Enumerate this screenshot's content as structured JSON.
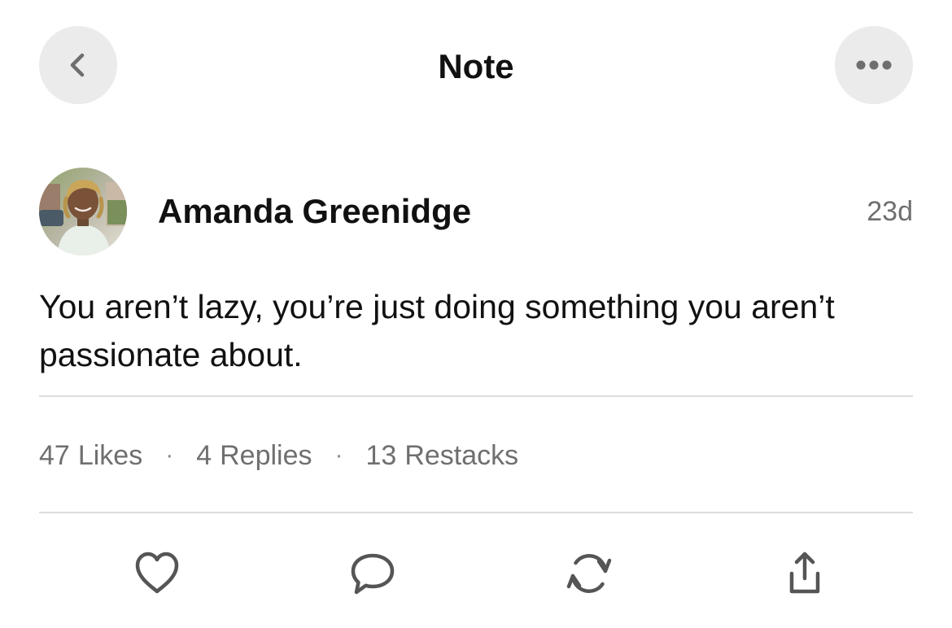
{
  "header": {
    "title": "Note",
    "back_icon": "chevron-left-icon",
    "more_icon": "more-horizontal-icon"
  },
  "author": {
    "name": "Amanda Greenidge",
    "timestamp": "23d"
  },
  "note": {
    "text": "You aren’t lazy, you’re just doing something you aren’t passionate about."
  },
  "stats": {
    "likes_count": "47",
    "likes_label": "Likes",
    "replies_count": "4",
    "replies_label": "Replies",
    "restacks_count": "13",
    "restacks_label": "Restacks",
    "separator": "·"
  },
  "actions": {
    "like_icon": "heart-icon",
    "reply_icon": "comment-icon",
    "restack_icon": "restack-icon",
    "share_icon": "share-icon"
  },
  "colors": {
    "text_primary": "#111111",
    "text_secondary": "#6f6f6f",
    "button_bg": "#ebebeb",
    "divider": "#dddddd"
  }
}
